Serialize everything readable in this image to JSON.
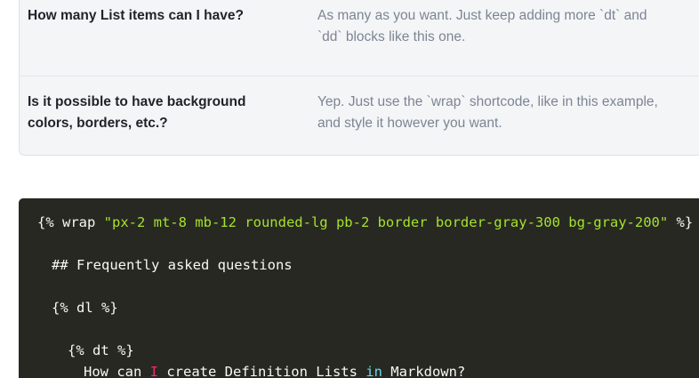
{
  "faq": {
    "items": [
      {
        "question": "How many List items can I have?",
        "answer_line1": "As many as you want. Just keep adding more `dt` and",
        "answer_line2": "`dd` blocks like this one."
      },
      {
        "question_line1": "Is it possible to have background",
        "question_line2": "colors, borders, etc.?",
        "answer_line1": "Yep. Just use the `wrap` shortcode, like in this example,",
        "answer_line2": "and style it however you want."
      }
    ]
  },
  "code": {
    "line1_open": "{% wrap ",
    "line1_string": "\"px-2 mt-8 mb-12 rounded-lg pb-2 border border-gray-300 bg-gray-200\"",
    "line1_close": " %}",
    "line2": "## Frequently asked questions",
    "line3": "{% dl %}",
    "line4": "{% dt %}",
    "line5_a": "How can ",
    "line5_b": "I",
    "line5_c": " create Definition Lists ",
    "line5_d": "in",
    "line5_e": " Markdown?"
  },
  "colors": {
    "faq_background": "#f4f5f7",
    "code_background": "#272822",
    "string_color": "#a6e22e",
    "keyword_red": "#f92672",
    "keyword_cyan": "#66d9ef"
  }
}
